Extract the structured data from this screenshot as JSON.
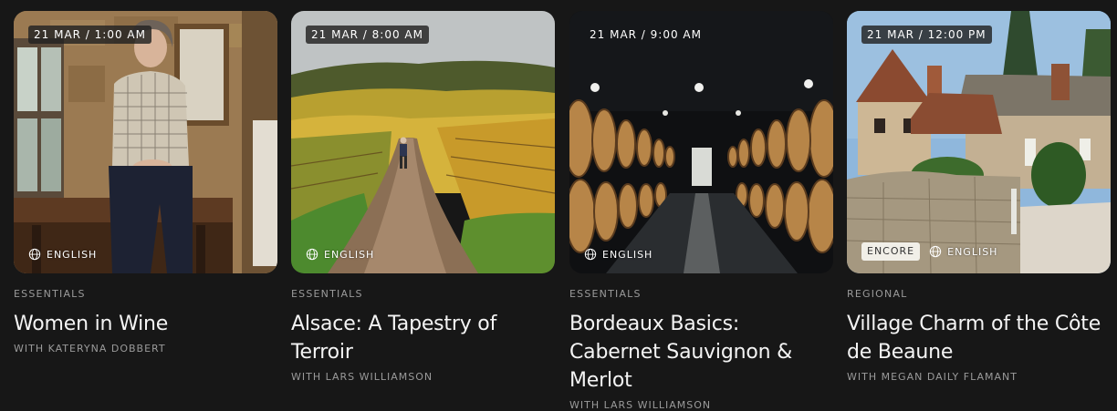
{
  "cards": [
    {
      "datetime": "21 MAR / 1:00 AM",
      "language": "ENGLISH",
      "category": "ESSENTIALS",
      "title": "Women in Wine",
      "host": "WITH KATERYNA DOBBERT"
    },
    {
      "datetime": "21 MAR / 8:00 AM",
      "language": "ENGLISH",
      "category": "ESSENTIALS",
      "title": "Alsace: A Tapestry of Terroir",
      "host": "WITH LARS WILLIAMSON"
    },
    {
      "datetime": "21 MAR / 9:00 AM",
      "language": "ENGLISH",
      "category": "ESSENTIALS",
      "title": "Bordeaux Basics: Cabernet Sauvignon & Merlot",
      "host": "WITH LARS WILLIAMSON"
    },
    {
      "datetime": "21 MAR / 12:00 PM",
      "badge": "ENCORE",
      "language": "ENGLISH",
      "category": "REGIONAL",
      "title": "Village Charm of the Côte de Beaune",
      "host": "WITH MEGAN DAILY FLAMANT"
    }
  ],
  "colors": {
    "background": "#171717",
    "muted_text": "#9a9a9a",
    "title_text": "#f4f4f4"
  }
}
